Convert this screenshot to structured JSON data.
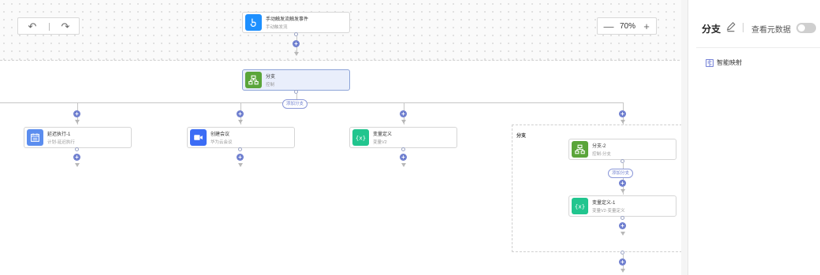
{
  "toolbar": {
    "undo_icon": "undo-icon",
    "redo_icon": "redo-icon",
    "zoom_out": "—",
    "zoom_level": "70%",
    "zoom_in": "+"
  },
  "trigger": {
    "title": "手动触发流触发事件",
    "subtitle": "手动触发流",
    "color": "#1e90ff",
    "icon": "hand-pointer-icon"
  },
  "branch_node": {
    "title": "分支",
    "subtitle": "控制",
    "color": "#5aa53a",
    "icon": "branch-icon"
  },
  "add_branch_label": "添加分支",
  "branches": [
    {
      "title": "延迟执行-1",
      "subtitle": "计划-延迟执行",
      "color": "#5b8def",
      "icon": "calendar-icon"
    },
    {
      "title": "创建会议",
      "subtitle": "华为云会议",
      "color": "#3b6cf5",
      "icon": "video-camera-icon"
    },
    {
      "title": "变量定义",
      "subtitle": "变量V2",
      "color": "#21c58e",
      "icon": "variable-icon"
    }
  ],
  "group": {
    "label": "分支",
    "branch_node": {
      "title": "分支-2",
      "subtitle": "控制-分支",
      "color": "#5aa53a",
      "icon": "branch-icon"
    },
    "add_branch_label": "添加分支",
    "var_node": {
      "title": "变量定义-1",
      "subtitle": "变量V2-变量定义",
      "color": "#21c58e",
      "icon": "variable-icon"
    }
  },
  "panel": {
    "title": "分支",
    "meta_label": "查看元数据",
    "toggle_on": false,
    "smart_mapping": "智能映射"
  }
}
